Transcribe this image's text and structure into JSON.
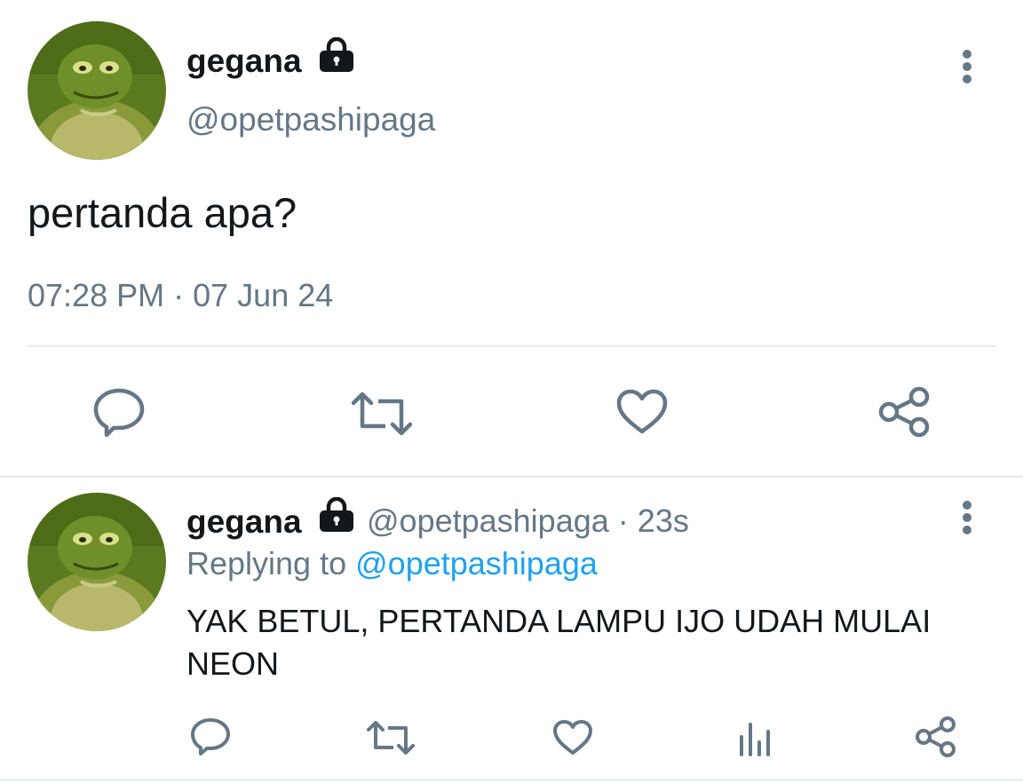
{
  "colors": {
    "text": "#14171a",
    "muted": "#657786",
    "link": "#1da1f2",
    "divider": "#e6ecf0",
    "icon": "#657786"
  },
  "main_tweet": {
    "display_name": "gegana",
    "handle": "@opetpashipaga",
    "protected_icon": "lock-icon",
    "text": "pertanda apa?",
    "time": "07:28 PM",
    "separator": "·",
    "date": "07 Jun 24",
    "actions": [
      "reply-icon",
      "retweet-icon",
      "like-icon",
      "share-icon"
    ]
  },
  "reply_tweet": {
    "display_name": "gegana",
    "handle": "@opetpashipaga",
    "separator": "·",
    "age": "23s",
    "replying_label": "Replying to",
    "replying_handle": "@opetpashipaga",
    "text": "YAK BETUL, PERTANDA LAMPU IJO UDAH MULAI NEON",
    "actions": [
      "reply-icon",
      "retweet-icon",
      "like-icon",
      "analytics-icon",
      "share-icon"
    ]
  }
}
